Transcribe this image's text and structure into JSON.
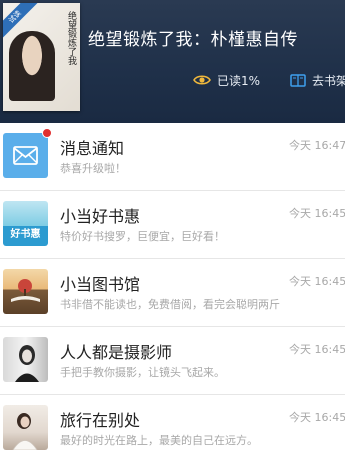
{
  "header": {
    "cover": {
      "ribbon": "试读",
      "title": "绝望锻炼了我"
    },
    "book_title": "绝望锻炼了我：朴槿惠自传",
    "read_progress": "已读1%",
    "shelf_label": "去书架"
  },
  "list": [
    {
      "title": "消息通知",
      "subtitle": "恭喜升级啦！",
      "time": "今天 16:47",
      "icon": "mail-icon",
      "unread": true
    },
    {
      "title": "小当好书惠",
      "subtitle": "特价好书搜罗，巨便宜，巨好看！",
      "time": "今天 16:45",
      "icon": "book-deal-thumbnail",
      "thumb_text": "好书惠"
    },
    {
      "title": "小当图书馆",
      "subtitle": "书非借不能读也，免费借阅，看完会聪明两斤",
      "time": "今天 16:45",
      "icon": "library-thumbnail"
    },
    {
      "title": "人人都是摄影师",
      "subtitle": "手把手教你摄影，让镜头飞起来。",
      "time": "今天 16:45",
      "icon": "photographer-thumbnail"
    },
    {
      "title": "旅行在别处",
      "subtitle": "最好的时光在路上，最美的自己在远方。",
      "time": "今天 16:45",
      "icon": "travel-thumbnail"
    }
  ],
  "colors": {
    "header_bg": "#1f3049",
    "mail_icon_bg": "#5aaeea",
    "badge": "#e02f2f"
  }
}
